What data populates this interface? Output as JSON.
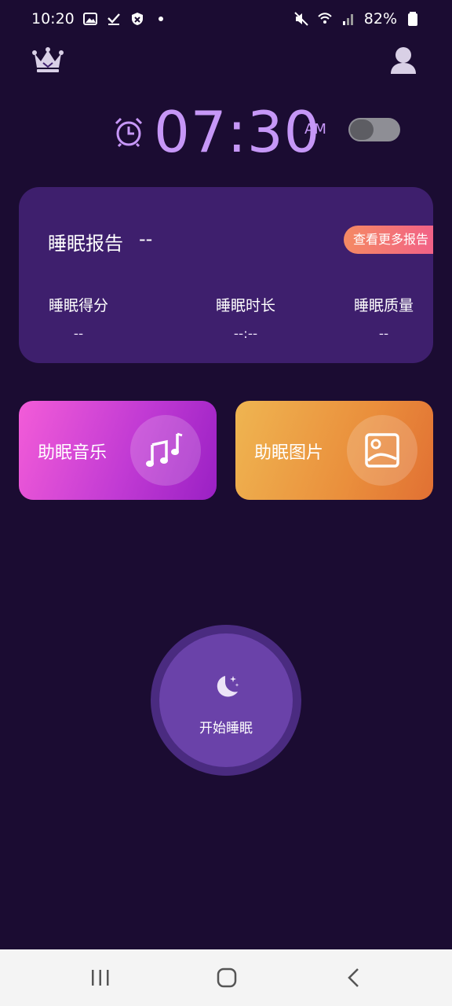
{
  "status_bar": {
    "time": "10:20",
    "battery": "82%",
    "left_icons": [
      "gallery-icon",
      "check-icon",
      "shield-icon",
      "dot-icon"
    ],
    "right_icons": [
      "mute-icon",
      "wifi-icon",
      "signal-icon",
      "battery-icon"
    ]
  },
  "header": {
    "left_icon": "crown-icon",
    "right_icon": "user-icon"
  },
  "alarm": {
    "time": "07:30",
    "ampm": "AM",
    "enabled": false,
    "accent_color": "#c697f7"
  },
  "report": {
    "title": "睡眠报告",
    "date": "--",
    "more_label": "查看更多报告",
    "stats": [
      {
        "label": "睡眠得分",
        "value": "--"
      },
      {
        "label": "睡眠时长",
        "value": "--:--"
      },
      {
        "label": "睡眠质量",
        "value": "--"
      }
    ]
  },
  "features": [
    {
      "label": "助眠音乐",
      "icon": "music-note-icon"
    },
    {
      "label": "助眠图片",
      "icon": "image-icon"
    }
  ],
  "sleep_button": {
    "label": "开始睡眠",
    "icon": "moon-icon"
  },
  "nav": {
    "icons": [
      "recents-icon",
      "home-icon",
      "back-icon"
    ]
  }
}
